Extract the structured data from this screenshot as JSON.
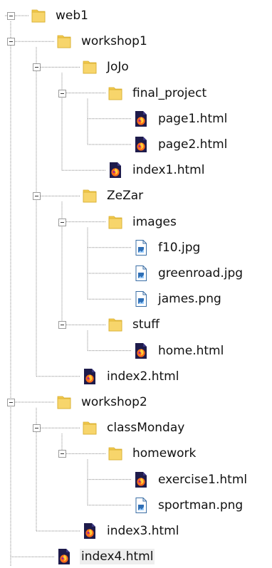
{
  "tree": {
    "nodes": [
      {
        "label": "web1",
        "type": "folder",
        "depth": 0,
        "expanded": true
      },
      {
        "label": "workshop1",
        "type": "folder",
        "depth": 1,
        "expanded": true
      },
      {
        "label": "JoJo",
        "type": "folder",
        "depth": 2,
        "expanded": true
      },
      {
        "label": "final_project",
        "type": "folder",
        "depth": 3,
        "expanded": true
      },
      {
        "label": "page1.html",
        "type": "html",
        "depth": 4
      },
      {
        "label": "page2.html",
        "type": "html",
        "depth": 4
      },
      {
        "label": "index1.html",
        "type": "html",
        "depth": 3
      },
      {
        "label": "ZeZar",
        "type": "folder",
        "depth": 2,
        "expanded": true
      },
      {
        "label": "images",
        "type": "folder",
        "depth": 3,
        "expanded": true
      },
      {
        "label": "f10.jpg",
        "type": "image",
        "depth": 4
      },
      {
        "label": "greenroad.jpg",
        "type": "image",
        "depth": 4
      },
      {
        "label": "james.png",
        "type": "image",
        "depth": 4
      },
      {
        "label": "stuff",
        "type": "folder",
        "depth": 3,
        "expanded": true
      },
      {
        "label": "home.html",
        "type": "html",
        "depth": 4
      },
      {
        "label": "index2.html",
        "type": "html",
        "depth": 2
      },
      {
        "label": "workshop2",
        "type": "folder",
        "depth": 1,
        "expanded": true
      },
      {
        "label": "classMonday",
        "type": "folder",
        "depth": 2,
        "expanded": true
      },
      {
        "label": "homework",
        "type": "folder",
        "depth": 3,
        "expanded": true
      },
      {
        "label": "exercise1.html",
        "type": "html",
        "depth": 4
      },
      {
        "label": "sportman.png",
        "type": "image",
        "depth": 4
      },
      {
        "label": "index3.html",
        "type": "html",
        "depth": 2
      },
      {
        "label": "index4.html",
        "type": "html",
        "depth": 1,
        "selected": true
      }
    ]
  },
  "colors": {
    "folder_fill": "#f7d56b",
    "folder_tab": "#f2c94c",
    "folder_stroke": "#d8ad2e",
    "html_bg": "#1e1b4b",
    "html_flame": "#ff6b1a",
    "image_stroke": "#3a6ea5",
    "image_fill": "#2f6fb6",
    "dotted_line": "#8a8a8a",
    "selection": "#eeeeee"
  },
  "icons": {
    "folder": "folder-icon",
    "html": "firefox-html-file-icon",
    "image": "image-file-icon",
    "toggle": "collapse-minus-icon"
  }
}
